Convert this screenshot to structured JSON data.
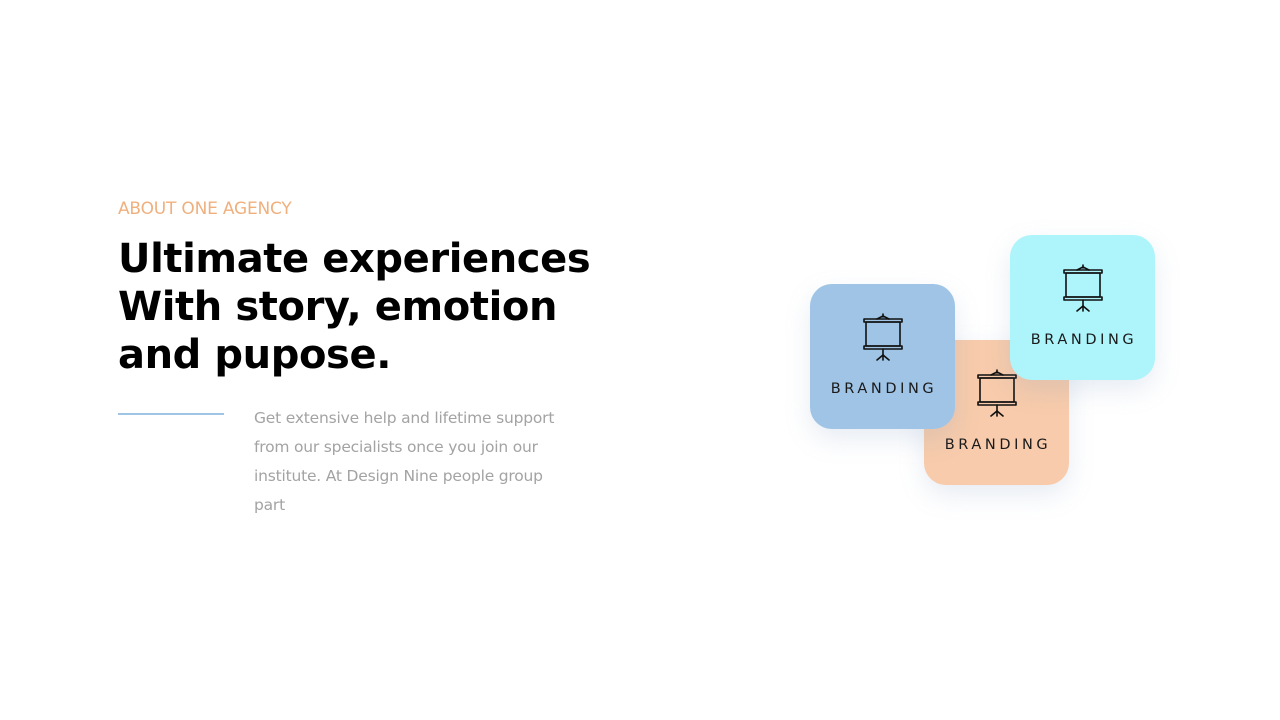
{
  "eyebrow": "ABOUT ONE AGENCY",
  "headline": {
    "line1": "Ultimate experiences",
    "line2": "With story, emotion",
    "line3": "and pupose."
  },
  "body": {
    "line1": "Get extensive help and lifetime support",
    "line2": "from our specialists once you join our",
    "line3": "institute. At Design Nine people group",
    "line4": "part"
  },
  "cards": [
    {
      "label": "BRANDING",
      "icon": "projector-screen-icon",
      "color": "#9fc4e6"
    },
    {
      "label": "BRANDING",
      "icon": "projector-screen-icon",
      "color": "#f7cbab"
    },
    {
      "label": "BRANDING",
      "icon": "projector-screen-icon",
      "color": "#aef4fb"
    }
  ],
  "colors": {
    "accent": "#f0b07e",
    "divider": "#9fc4e6",
    "body_text": "#a3a3a3"
  }
}
